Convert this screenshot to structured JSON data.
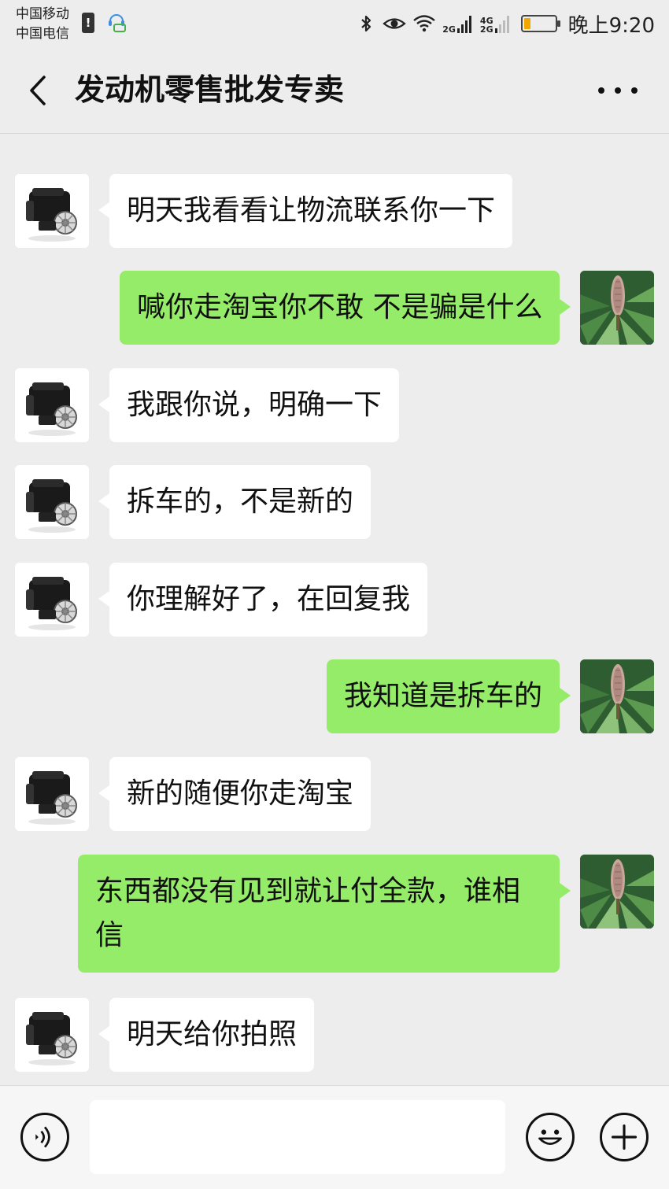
{
  "status_bar": {
    "carrier_1": "中国移动",
    "carrier_2": "中国电信",
    "network_1": "2G",
    "network_2a": "4G",
    "network_2b": "2G",
    "battery_level": 0.2,
    "battery_color": "#f0a800",
    "time": "晚上9:20"
  },
  "header": {
    "title": "发动机零售批发专卖"
  },
  "colors": {
    "background": "#ededed",
    "bubble_incoming": "#ffffff",
    "bubble_outgoing": "#95ec69"
  },
  "messages": [
    {
      "side": "left",
      "text": "明天我看看让物流联系你一下",
      "avatar": "engine-avatar"
    },
    {
      "side": "right",
      "text": "喊你走淘宝你不敢 不是骗是什么",
      "avatar": "plant-avatar"
    },
    {
      "side": "left",
      "text": "我跟你说，明确一下",
      "avatar": "engine-avatar"
    },
    {
      "side": "left",
      "text": "拆车的，不是新的",
      "avatar": "engine-avatar"
    },
    {
      "side": "left",
      "text": "你理解好了，在回复我",
      "avatar": "engine-avatar"
    },
    {
      "side": "right",
      "text": "我知道是拆车的",
      "avatar": "plant-avatar"
    },
    {
      "side": "left",
      "text": "新的随便你走淘宝",
      "avatar": "engine-avatar"
    },
    {
      "side": "right",
      "text": "东西都没有见到就让付全款，谁相信",
      "avatar": "plant-avatar"
    },
    {
      "side": "left",
      "text": "明天给你拍照",
      "avatar": "engine-avatar"
    }
  ],
  "input_bar": {
    "value": "",
    "icons": [
      "voice-icon",
      "emoji-icon",
      "plus-icon"
    ]
  }
}
